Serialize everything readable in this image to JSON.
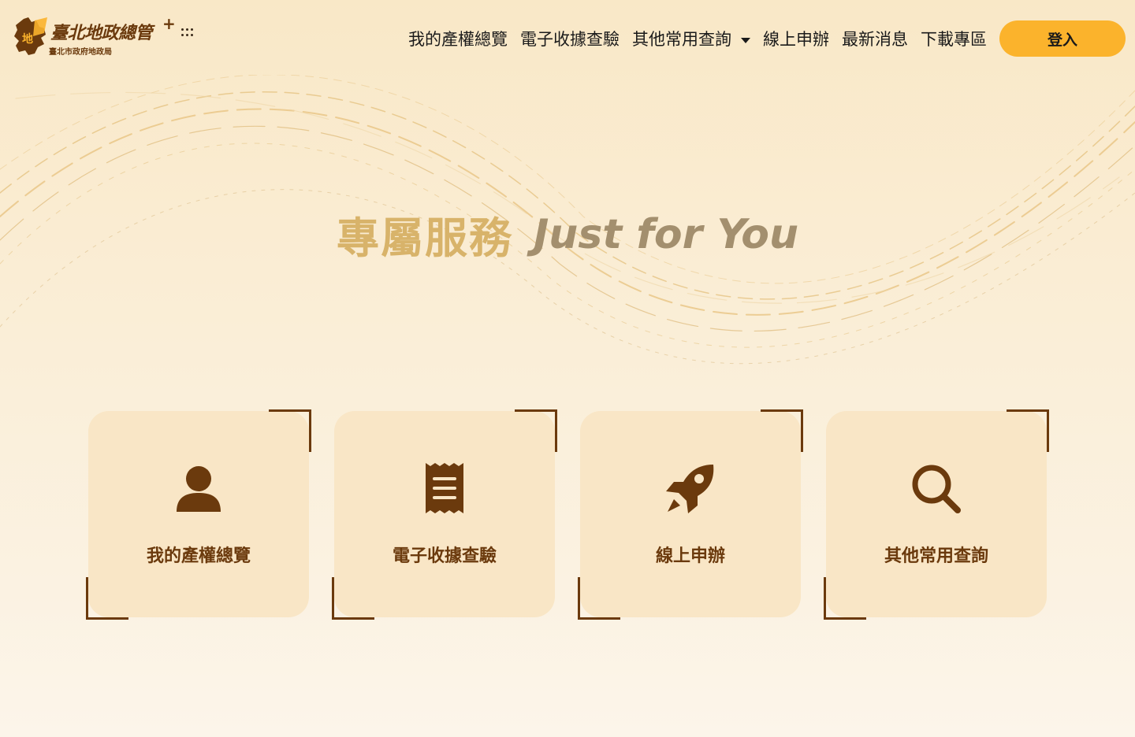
{
  "header": {
    "logo_title": "臺北地政總管",
    "logo_plus": "+",
    "logo_subtitle": "臺北市政府地政局",
    "nav": [
      {
        "label": "我的產權總覽"
      },
      {
        "label": "電子收據查驗"
      },
      {
        "label": "其他常用查詢",
        "has_dropdown": true
      },
      {
        "label": "線上申辦"
      },
      {
        "label": "最新消息"
      },
      {
        "label": "下載專區"
      }
    ],
    "login_label": "登入"
  },
  "hero": {
    "title_zh": "專屬服務",
    "title_en": "Just for You"
  },
  "cards": [
    {
      "label": "我的產權總覽",
      "icon": "user-icon"
    },
    {
      "label": "電子收據查驗",
      "icon": "receipt-icon"
    },
    {
      "label": "線上申辦",
      "icon": "rocket-icon"
    },
    {
      "label": "其他常用查詢",
      "icon": "search-icon"
    }
  ],
  "colors": {
    "brand_brown": "#6b3a0d",
    "accent_yellow": "#fbb32c",
    "card_bg": "#f9e6c6",
    "hero_zh": "#d8b36a",
    "hero_en": "#a38f6e"
  }
}
